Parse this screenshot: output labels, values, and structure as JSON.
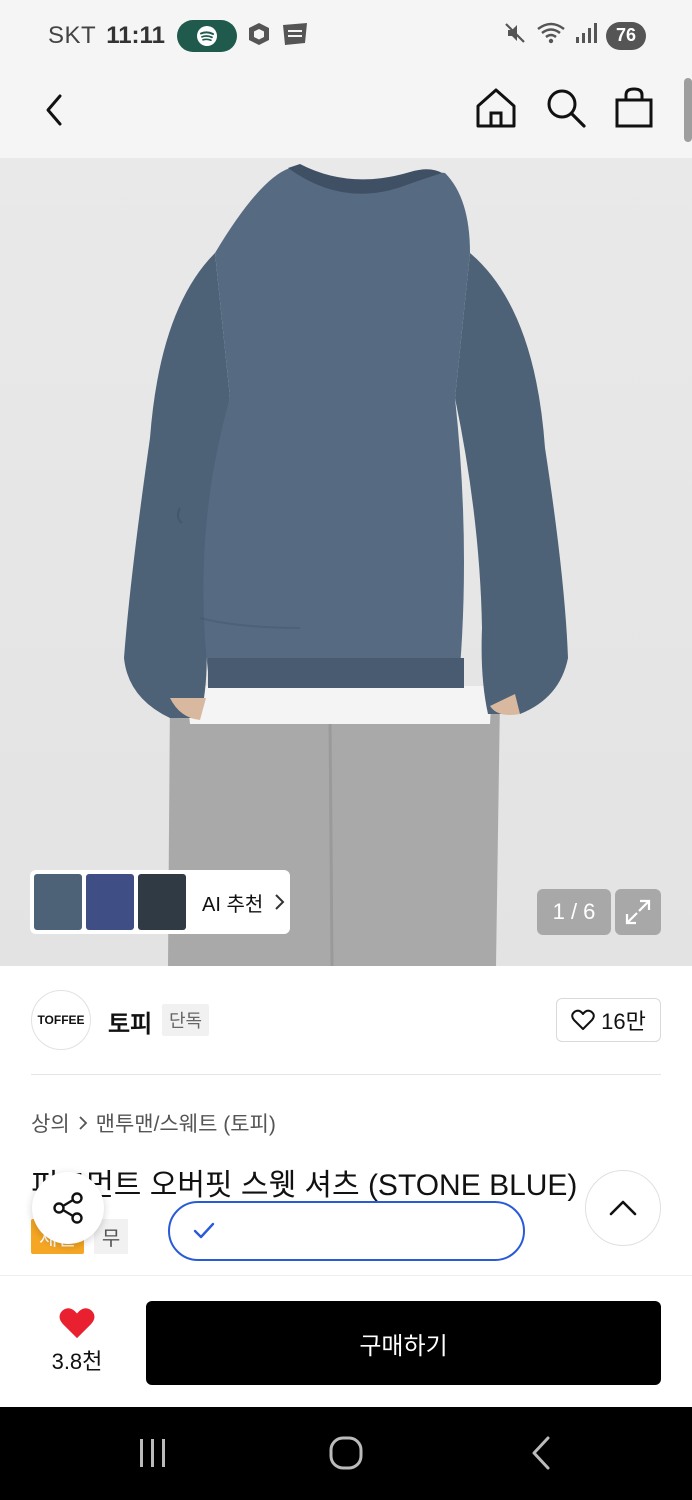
{
  "status_bar": {
    "carrier": "SKT",
    "time": "11:11",
    "battery": "76"
  },
  "header": {
    "icons": [
      "back-icon",
      "home-icon",
      "search-icon",
      "shopping-bag-icon"
    ]
  },
  "gallery": {
    "ai_label": "AI 추천",
    "page_counter": "1 / 6"
  },
  "brand": {
    "logo_text": "TOFFEE",
    "name": "토피",
    "tag": "단독",
    "likes": "16만"
  },
  "product": {
    "breadcrumb": {
      "category": "상의",
      "subcategory": "맨투맨/스웨트 (토피)"
    },
    "title": "피그먼트 오버핏 스웻 셔츠 (STONE BLUE)",
    "badge_sale": "세일",
    "badge_free": "무"
  },
  "purchase": {
    "wish_count": "3.8천",
    "buy_label": "구매하기"
  },
  "colors": {
    "sweatshirt": "#4d6177",
    "sale_badge": "#f5a623",
    "toast_border": "#2a5bd7",
    "heart": "#e8202f"
  }
}
